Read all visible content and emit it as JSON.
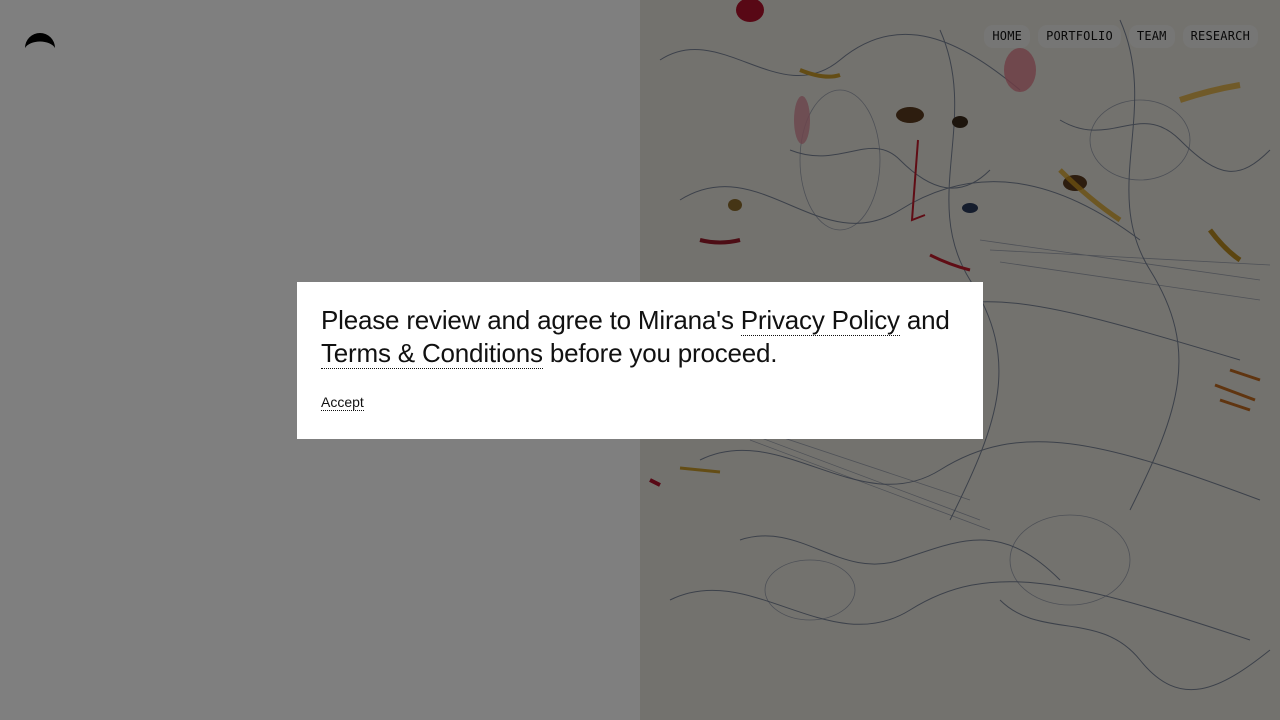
{
  "site": {
    "logo_icon": "half-moon-logo-icon"
  },
  "nav": {
    "items": [
      {
        "label": "HOME"
      },
      {
        "label": "PORTFOLIO"
      },
      {
        "label": "TEAM"
      },
      {
        "label": "RESEARCH"
      }
    ]
  },
  "modal": {
    "message_part1": "Please review and agree to Mirana's ",
    "privacy_link": "Privacy Policy",
    "message_part2": " and ",
    "terms_link": "Terms & Conditions",
    "message_part3": " before you proceed.",
    "accept_label": "Accept"
  },
  "colors": {
    "overlay": "#7f7f7f",
    "modal_bg": "#ffffff",
    "text": "#111111",
    "nav_pill": "#ececea"
  }
}
